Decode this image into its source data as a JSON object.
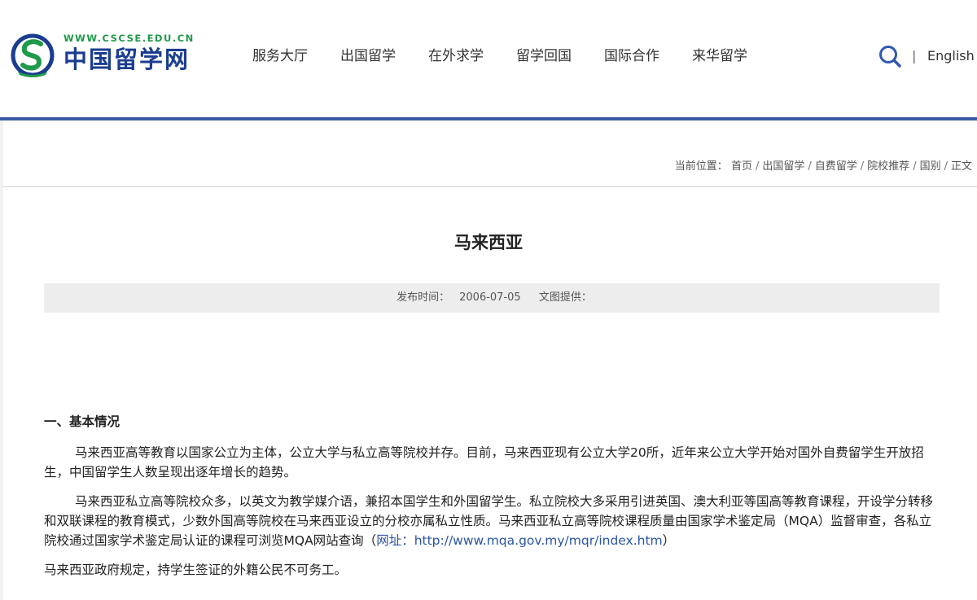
{
  "header": {
    "site_url": "WWW.CSCSE.EDU.CN",
    "site_name": "中国留学网",
    "nav": [
      "服务大厅",
      "出国留学",
      "在外求学",
      "留学回国",
      "国际合作",
      "来华留学"
    ],
    "divider": "|",
    "english": "English"
  },
  "breadcrumb": {
    "prefix": "当前位置：",
    "items": [
      "首页",
      "出国留学",
      "自费留学",
      "院校推荐",
      "国别",
      "正文"
    ],
    "separator": "/"
  },
  "article": {
    "title": "马来西亚",
    "publish_label": "发布时间：",
    "publish_date": "2006-07-05",
    "provider_label": "文图提供：",
    "section1_heading": "一、基本情况",
    "para1": "马来西亚高等教育以国家公立为主体，公立大学与私立高等院校并存。目前，马来西亚现有公立大学20所，近年来公立大学开始对国外自费留学生开放招生，中国留学生人数呈现出逐年增长的趋势。",
    "para2_text": "马来西亚私立高等院校众多，以英文为教学媒介语，兼招本国学生和外国留学生。私立院校大多采用引进英国、澳大利亚等国高等教育课程，开设学分转移和双联课程的教育模式，少数外国高等院校在马来西亚设立的分校亦属私立性质。马来西亚私立高等院校课程质量由国家学术鉴定局（MQA）监督审查，各私立院校通过国家学术鉴定局认证的课程可浏览MQA网站查询（",
    "para2_link": "网址：http://www.mqa.gov.my/mqr/index.htm",
    "para2_end": "）",
    "para3": "马来西亚政府规定，持学生签证的外籍公民不可务工。"
  },
  "colors": {
    "brand_blue": "#3b5ba5",
    "logo_green": "#1f9a4a",
    "link_blue": "#2b55a5"
  },
  "icons": {
    "search": "search-icon",
    "logo": "cscse-logo-icon"
  }
}
